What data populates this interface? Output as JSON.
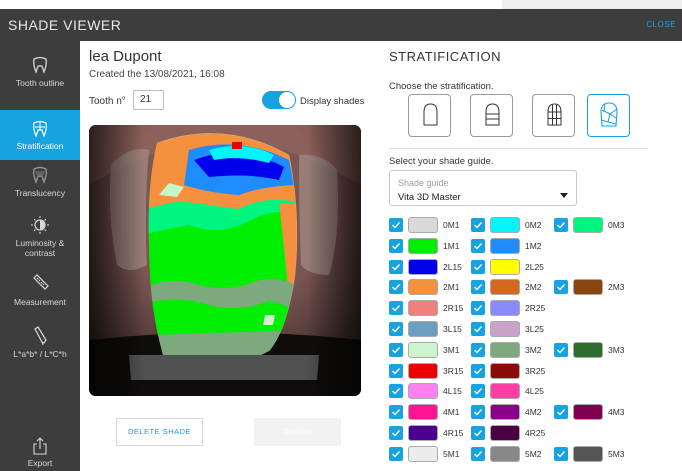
{
  "app": {
    "title": "SHADE VIEWER",
    "close_label": "CLOSE"
  },
  "sidebar": {
    "items": [
      {
        "label": "Tooth outline"
      },
      {
        "label": "Stratification"
      },
      {
        "label": "Translucency"
      },
      {
        "label": "Luminosity & contrast"
      },
      {
        "label": "Measurement"
      },
      {
        "label": "L*a*b* / L*C*h"
      },
      {
        "label": "Export"
      }
    ]
  },
  "patient": {
    "name": "lea Dupont",
    "created": "Created the 13/08/2021, 16:08",
    "tooth_label": "Tooth n°",
    "tooth_number": "21",
    "display_shades_label": "Display shades",
    "display_shades_on": true
  },
  "actions": {
    "delete_label": "DELETE SHADE",
    "order_label": "ORDER"
  },
  "stratification": {
    "title": "STRATIFICATION",
    "choose_label": "Choose the stratification.",
    "selected_option": 4,
    "guide_label": "Select your shade guide.",
    "guide_placeholder": "Shade guide",
    "guide_value": "Vita 3D Master"
  },
  "shades": [
    {
      "name": "0M1",
      "color": "#d9d9d9",
      "checked": true
    },
    {
      "name": "0M2",
      "color": "#00f5ff",
      "checked": true
    },
    {
      "name": "0M3",
      "color": "#00f57e",
      "checked": true
    },
    {
      "name": "1M1",
      "color": "#00ee00",
      "checked": true
    },
    {
      "name": "1M2",
      "color": "#1e8cff",
      "checked": true
    },
    {
      "name": "2L15",
      "color": "#0000ee",
      "checked": true
    },
    {
      "name": "2L25",
      "color": "#ffff00",
      "checked": true
    },
    {
      "name": "2M1",
      "color": "#f5903e",
      "checked": true
    },
    {
      "name": "2M2",
      "color": "#d2691e",
      "checked": true
    },
    {
      "name": "2M3",
      "color": "#8b4513",
      "checked": true
    },
    {
      "name": "2R15",
      "color": "#f08080",
      "checked": true
    },
    {
      "name": "2R25",
      "color": "#8a8aff",
      "checked": true
    },
    {
      "name": "3L15",
      "color": "#6c9ec2",
      "checked": true
    },
    {
      "name": "3L25",
      "color": "#c8a2c8",
      "checked": true
    },
    {
      "name": "3M1",
      "color": "#cdf5cd",
      "checked": true
    },
    {
      "name": "3M2",
      "color": "#7ea97e",
      "checked": true
    },
    {
      "name": "3M3",
      "color": "#2e6b2e",
      "checked": true
    },
    {
      "name": "3R15",
      "color": "#ee0000",
      "checked": true
    },
    {
      "name": "3R25",
      "color": "#8b0a0a",
      "checked": true
    },
    {
      "name": "4L15",
      "color": "#ff80ee",
      "checked": true
    },
    {
      "name": "4L25",
      "color": "#ff3ea5",
      "checked": true
    },
    {
      "name": "4M1",
      "color": "#ff1493",
      "checked": true
    },
    {
      "name": "4M2",
      "color": "#8b008b",
      "checked": true
    },
    {
      "name": "4M3",
      "color": "#800050",
      "checked": true
    },
    {
      "name": "4R15",
      "color": "#4b0090",
      "checked": true
    },
    {
      "name": "4R25",
      "color": "#4a0040",
      "checked": true
    },
    {
      "name": "5M1",
      "color": "#ececec",
      "checked": true
    },
    {
      "name": "5M2",
      "color": "#888888",
      "checked": true
    },
    {
      "name": "5M3",
      "color": "#555555",
      "checked": true
    }
  ],
  "colors": {
    "accent": "#17a2e0",
    "sidebar": "#3d3d3d"
  }
}
